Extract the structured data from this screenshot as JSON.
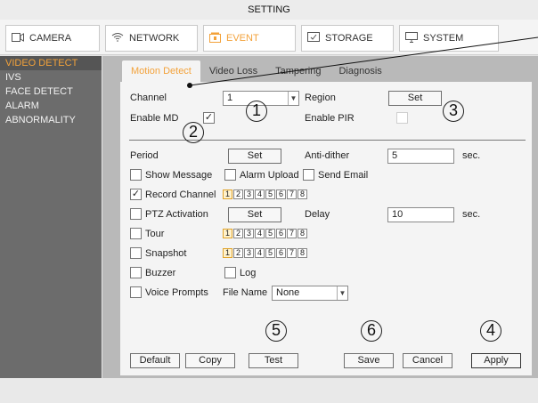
{
  "window": {
    "title": "SETTING"
  },
  "topnav": {
    "tabs": [
      {
        "label": "CAMERA",
        "icon": "camera-icon"
      },
      {
        "label": "NETWORK",
        "icon": "wifi-icon"
      },
      {
        "label": "EVENT",
        "icon": "event-icon",
        "active": true
      },
      {
        "label": "STORAGE",
        "icon": "storage-icon"
      },
      {
        "label": "SYSTEM",
        "icon": "monitor-icon"
      }
    ]
  },
  "sidebar": {
    "items": [
      {
        "label": "VIDEO DETECT",
        "active": true
      },
      {
        "label": "IVS"
      },
      {
        "label": "FACE DETECT"
      },
      {
        "label": "ALARM"
      },
      {
        "label": "ABNORMALITY"
      }
    ]
  },
  "subtabs": [
    {
      "label": "Motion Detect",
      "active": true
    },
    {
      "label": "Video Loss"
    },
    {
      "label": "Tampering"
    },
    {
      "label": "Diagnosis"
    }
  ],
  "form": {
    "channel_label": "Channel",
    "channel_value": "1",
    "region_label": "Region",
    "region_button": "Set",
    "enable_md_label": "Enable MD",
    "enable_md_checked": "✓",
    "enable_pir_label": "Enable PIR",
    "period_label": "Period",
    "period_button": "Set",
    "anti_dither_label": "Anti-dither",
    "anti_dither_value": "5",
    "anti_dither_unit": "sec.",
    "show_message_label": "Show Message",
    "alarm_upload_label": "Alarm Upload",
    "send_email_label": "Send Email",
    "record_channel_label": "Record Channel",
    "record_channel_checked": "✓",
    "ptz_label": "PTZ Activation",
    "ptz_button": "Set",
    "delay_label": "Delay",
    "delay_value": "10",
    "delay_unit": "sec.",
    "tour_label": "Tour",
    "snapshot_label": "Snapshot",
    "buzzer_label": "Buzzer",
    "log_label": "Log",
    "voice_prompts_label": "Voice Prompts",
    "file_name_label": "File Name",
    "file_name_value": "None",
    "channels": [
      "1",
      "2",
      "3",
      "4",
      "5",
      "6",
      "7",
      "8"
    ]
  },
  "buttons": {
    "default": "Default",
    "copy": "Copy",
    "test": "Test",
    "save": "Save",
    "cancel": "Cancel",
    "apply": "Apply"
  },
  "callouts": [
    "1",
    "2",
    "3",
    "4",
    "5",
    "6"
  ],
  "colors": {
    "accent": "#f3a23a",
    "sidebar": "#6c6c6c",
    "main_bg": "#b9b9b9",
    "panel_bg": "#f4f4f4"
  }
}
